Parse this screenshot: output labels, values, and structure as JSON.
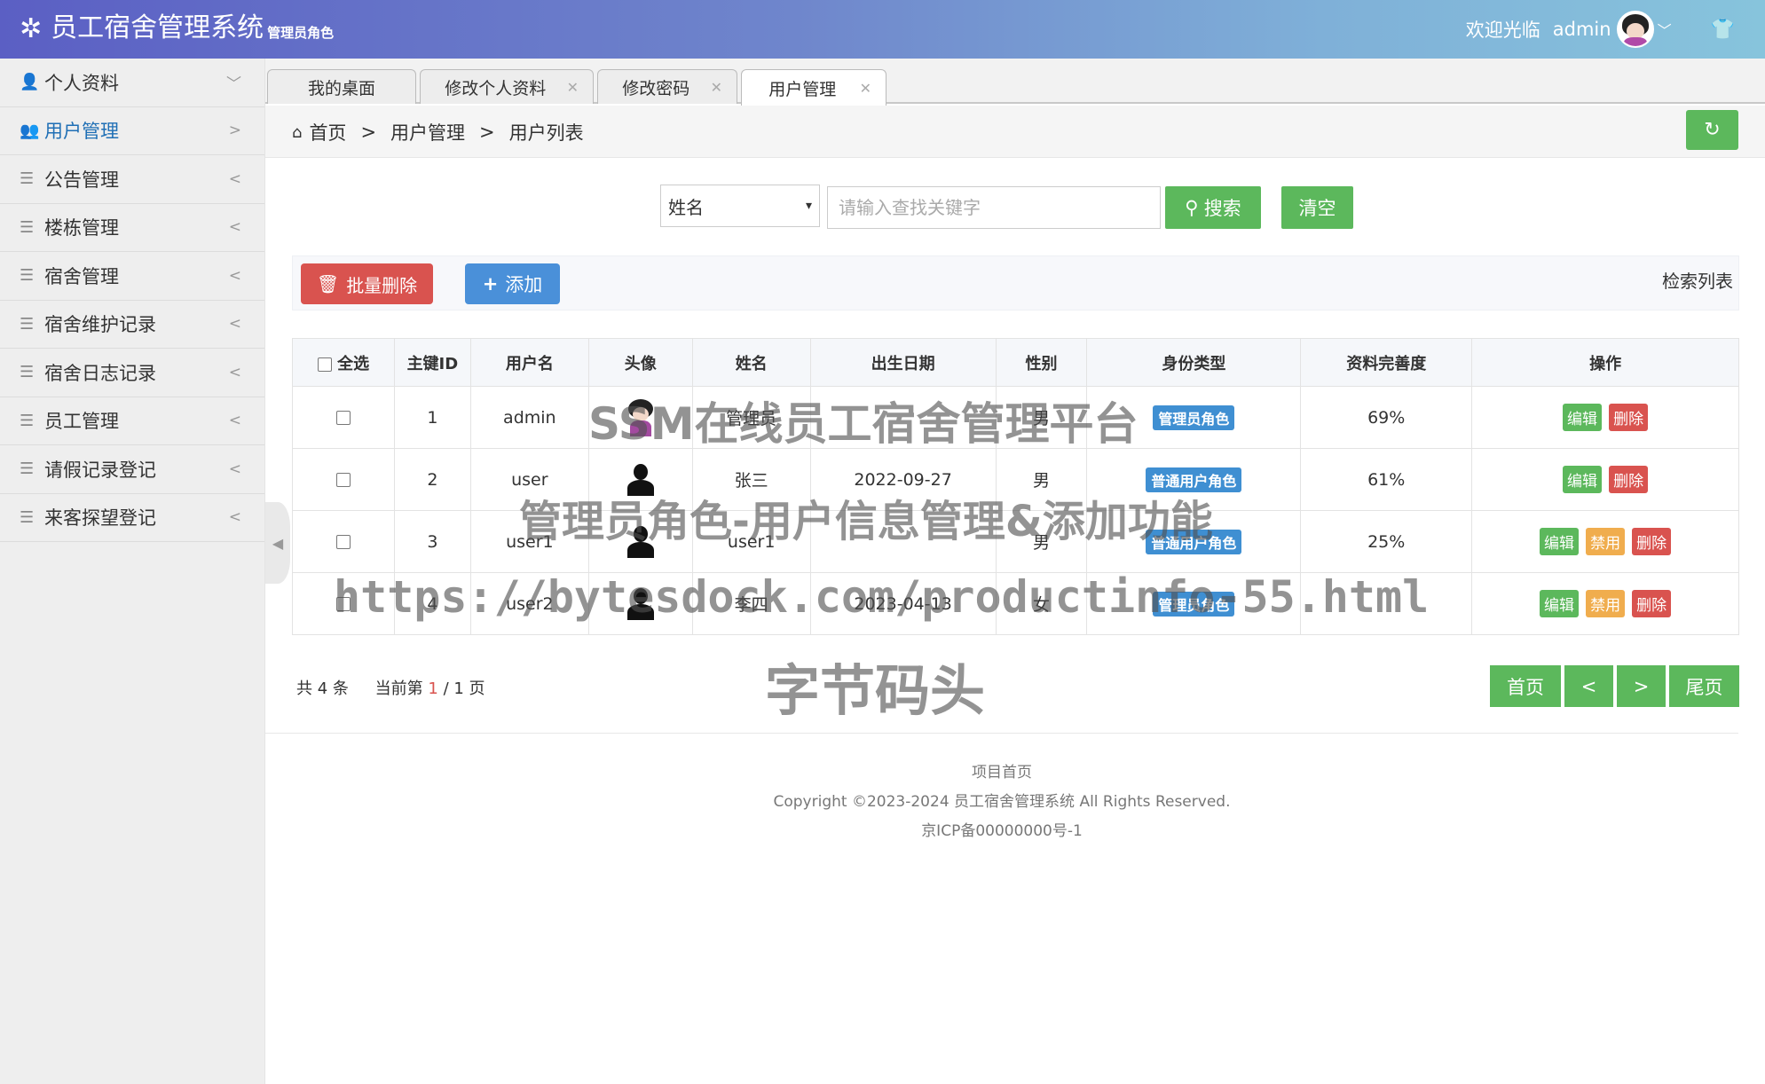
{
  "header": {
    "title": "员工宿舍管理系统",
    "role": "管理员角色",
    "welcome": "欢迎光临",
    "username": "admin"
  },
  "sidebar": {
    "items": [
      {
        "label": "个人资料",
        "arrow": "﹀"
      },
      {
        "label": "用户管理",
        "arrow": ">"
      },
      {
        "label": "公告管理",
        "arrow": "<"
      },
      {
        "label": "楼栋管理",
        "arrow": "<"
      },
      {
        "label": "宿舍管理",
        "arrow": "<"
      },
      {
        "label": "宿舍维护记录",
        "arrow": "<"
      },
      {
        "label": "宿舍日志记录",
        "arrow": "<"
      },
      {
        "label": "员工管理",
        "arrow": "<"
      },
      {
        "label": "请假记录登记",
        "arrow": "<"
      },
      {
        "label": "来客探望登记",
        "arrow": "<"
      }
    ]
  },
  "tabs": [
    {
      "label": "我的桌面"
    },
    {
      "label": "修改个人资料"
    },
    {
      "label": "修改密码"
    },
    {
      "label": "用户管理"
    }
  ],
  "breadcrumb": [
    "首页",
    "用户管理",
    "用户列表"
  ],
  "search": {
    "field": "姓名",
    "placeholder": "请输入查找关键字",
    "search_label": "搜索",
    "clear_label": "清空"
  },
  "toolbar": {
    "batch_delete": "批量删除",
    "add": "添加",
    "list_label": "检索列表"
  },
  "table": {
    "headers": [
      "全选",
      "主键ID",
      "用户名",
      "头像",
      "姓名",
      "出生日期",
      "性别",
      "身份类型",
      "资料完善度",
      "操作"
    ],
    "rows": [
      {
        "id": "1",
        "username": "admin",
        "name": "管理员",
        "birth": "",
        "gender": "男",
        "type": "管理员角色",
        "complete": "69%",
        "ops": [
          "编辑",
          "删除"
        ]
      },
      {
        "id": "2",
        "username": "user",
        "name": "张三",
        "birth": "2022-09-27",
        "gender": "男",
        "type": "普通用户角色",
        "complete": "61%",
        "ops": [
          "编辑",
          "删除"
        ]
      },
      {
        "id": "3",
        "username": "user1",
        "name": "user1",
        "birth": "",
        "gender": "男",
        "type": "普通用户角色",
        "complete": "25%",
        "ops": [
          "编辑",
          "禁用",
          "删除"
        ]
      },
      {
        "id": "4",
        "username": "user2",
        "name": "李四",
        "birth": "2023-04-13",
        "gender": "女",
        "type": "管理员角色",
        "complete": "",
        "ops": [
          "编辑",
          "禁用",
          "删除"
        ]
      }
    ]
  },
  "pagination": {
    "total_prefix": "共",
    "total": "4",
    "total_suffix": "条",
    "current_prefix": "当前第",
    "current": "1",
    "pages": "/ 1 页",
    "first": "首页",
    "prev": "<",
    "next": ">",
    "last": "尾页"
  },
  "footer": {
    "line1": "项目首页",
    "line2": "Copyright ©2023-2024 员工宿舍管理系统 All Rights Reserved.",
    "line3": "京ICP备00000000号-1"
  },
  "watermark": {
    "line1": "SSM在线员工宿舍管理平台",
    "line2": "管理员角色-用户信息管理&添加功能",
    "line3": "https://bytesdock.com/productinfo-55.html",
    "line4": "字节码头"
  },
  "colors": {
    "success": "#5cb85c",
    "danger": "#d9534f",
    "primary": "#4a90d9",
    "warning": "#f0ad4e"
  }
}
